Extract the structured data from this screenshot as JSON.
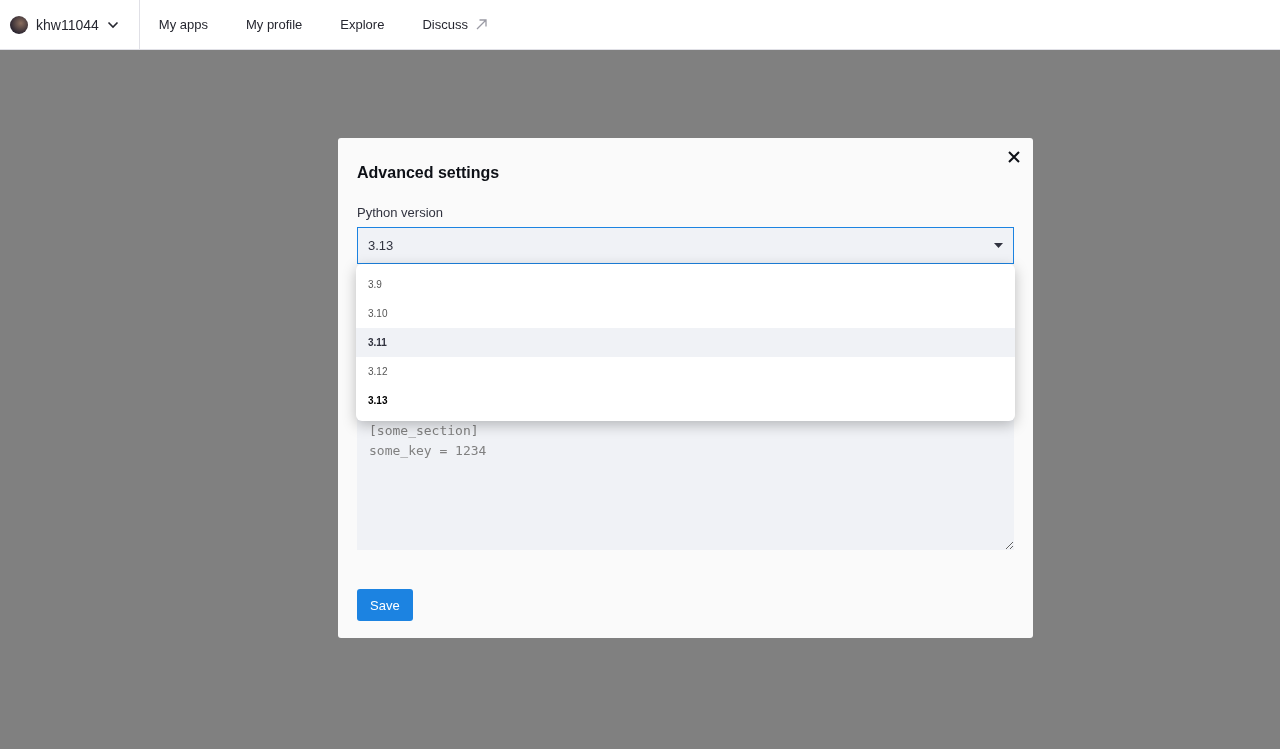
{
  "nav": {
    "user": {
      "name": "khw11044"
    },
    "links": [
      {
        "label": "My apps",
        "kind": "internal"
      },
      {
        "label": "My profile",
        "kind": "internal"
      },
      {
        "label": "Explore",
        "kind": "internal"
      },
      {
        "label": "Discuss",
        "kind": "external"
      }
    ]
  },
  "dialog": {
    "title": "Advanced settings",
    "python_version": {
      "label": "Python version",
      "value": "3.13",
      "expanded": true,
      "options": [
        {
          "label": "3.9",
          "selected": false,
          "highlighted": false
        },
        {
          "label": "3.10",
          "selected": false,
          "highlighted": false
        },
        {
          "label": "3.11",
          "selected": false,
          "highlighted": true
        },
        {
          "label": "3.12",
          "selected": false,
          "highlighted": false
        },
        {
          "label": "3.13",
          "selected": true,
          "highlighted": false
        }
      ]
    },
    "secrets": {
      "placeholder": "[some_section]\nsome_key = 1234"
    },
    "save_button": "Save"
  }
}
